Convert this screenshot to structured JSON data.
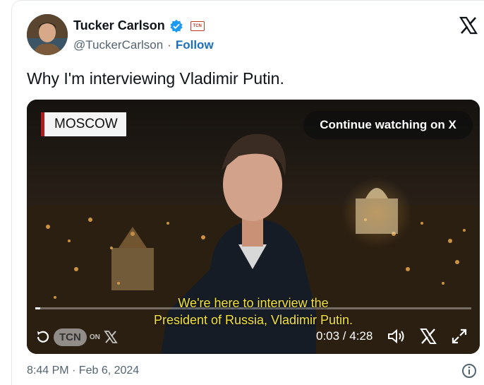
{
  "author": {
    "name": "Tucker Carlson",
    "handle": "@TuckerCarlson",
    "separator": "·",
    "follow_label": "Follow",
    "affiliate_badge": "TCN"
  },
  "tweet": {
    "text": "Why I'm interviewing Vladimir Putin."
  },
  "video": {
    "location_label": "MOSCOW",
    "continue_label": "Continue watching on X",
    "caption_line1": "We're here to interview the",
    "caption_line2": "President of Russia, Vladimir Putin.",
    "timecode": "0:03 / 4:28",
    "progress_fraction": 0.012,
    "watermark_badge": "TCN",
    "watermark_on": "ON",
    "icons": [
      "replay-icon",
      "volume-icon",
      "x-logo-icon",
      "fullscreen-icon"
    ]
  },
  "footer": {
    "timestamp": "8:44 PM · Feb 6, 2024"
  },
  "colors": {
    "follow": "#1d6fb8",
    "verified": "#1d9bf0",
    "caption": "#f2e23a",
    "location_accent": "#b01c1c"
  }
}
